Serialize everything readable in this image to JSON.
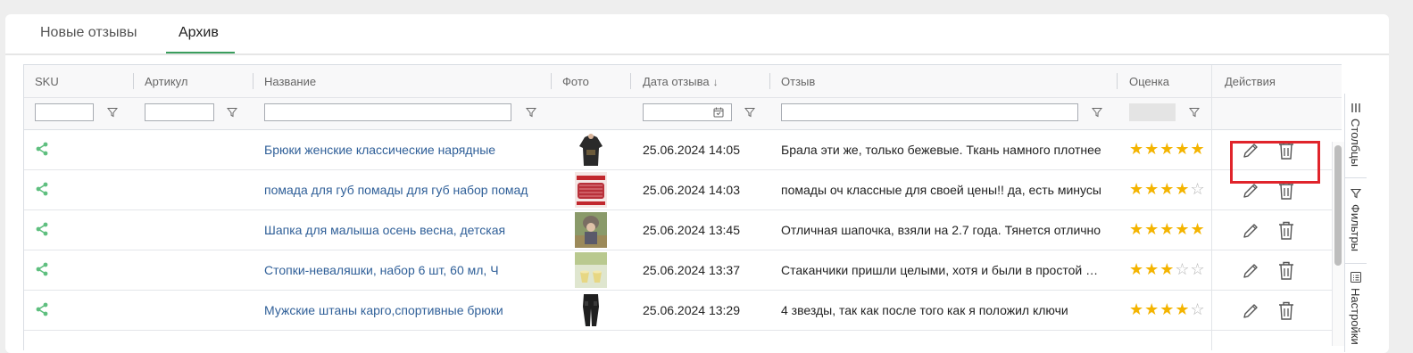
{
  "tabs": [
    {
      "label": "Новые отзывы",
      "active": false
    },
    {
      "label": "Архив",
      "active": true
    }
  ],
  "columns": {
    "sku": "SKU",
    "article": "Артикул",
    "name": "Название",
    "photo": "Фото",
    "date": "Дата отзыва",
    "review": "Отзыв",
    "rating": "Оценка",
    "actions": "Действия"
  },
  "sort_indicator": "↓",
  "rows": [
    {
      "name": "Брюки женские классические нарядные",
      "date": "25.06.2024 14:05",
      "review": "Брала эти же, только бежевые. Ткань намного плотнее",
      "rating": 5
    },
    {
      "name": "помада для губ помады для губ набор помад",
      "date": "25.06.2024 14:03",
      "review": "помады оч классные для своей цены!! да, есть минусы",
      "rating": 4
    },
    {
      "name": "Шапка для малыша осень весна, детская",
      "date": "25.06.2024 13:45",
      "review": "Отличная шапочка, взяли на 2.7 года. Тянется отлично",
      "rating": 5
    },
    {
      "name": "Стопки-неваляшки, набор 6 шт, 60 мл, Ч",
      "date": "25.06.2024 13:37",
      "review": "Стаканчики пришли целыми, хотя и были в простой упаковке",
      "rating": 3
    },
    {
      "name": "Мужские штаны карго,спортивные брюки",
      "date": "25.06.2024 13:29",
      "review": "4 звезды, так как после того как я положил ключи",
      "rating": 4
    }
  ],
  "side_panel": [
    {
      "label": "Столбцы",
      "icon": "columns-icon"
    },
    {
      "label": "Фильтры",
      "icon": "filter-icon"
    },
    {
      "label": "Настройки",
      "icon": "settings-list-icon"
    }
  ],
  "colors": {
    "accent": "#3a9d5d",
    "link": "#2f5f98",
    "star": "#f4b400",
    "highlight": "#e0242b"
  }
}
